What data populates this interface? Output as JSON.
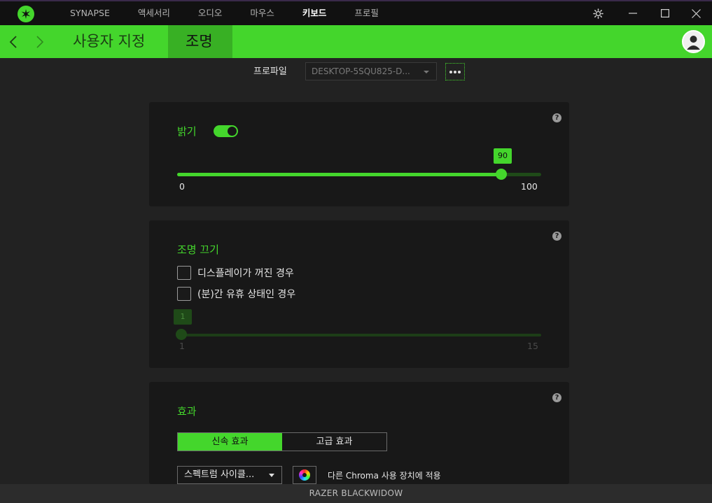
{
  "app": {
    "nav": [
      {
        "label": "SYNAPSE",
        "active": false
      },
      {
        "label": "액세서리",
        "active": false
      },
      {
        "label": "오디오",
        "active": false
      },
      {
        "label": "마우스",
        "active": false
      },
      {
        "label": "키보드",
        "active": true
      },
      {
        "label": "프로필",
        "active": false
      }
    ]
  },
  "header": {
    "tabs": [
      {
        "label": "사용자 지정",
        "active": false
      },
      {
        "label": "조명",
        "active": true
      }
    ]
  },
  "profile": {
    "label": "프로파일",
    "selected": "DESKTOP-5SQU825-D..."
  },
  "brightness": {
    "title": "밝기",
    "enabled": true,
    "value": "90",
    "min": "0",
    "max": "100",
    "help": "?"
  },
  "lighting_off": {
    "title": "조명 끄기",
    "options": [
      {
        "label": "디스플레이가 꺼진 경우",
        "checked": false
      },
      {
        "label": "(분)간 유휴 상태인 경우",
        "checked": false
      }
    ],
    "value": "1",
    "min": "1",
    "max": "15",
    "help": "?"
  },
  "effects": {
    "title": "효과",
    "modes": [
      {
        "label": "신속 효과",
        "active": true
      },
      {
        "label": "고급 효과",
        "active": false
      }
    ],
    "selected_effect": "스펙트럼 사이클...",
    "chroma_label": "다른 Chroma 사용 장치에 적용",
    "help": "?"
  },
  "footer": {
    "device": "RAZER BLACKWIDOW"
  },
  "colors": {
    "accent": "#44d62c",
    "accent_dark": "#38b024",
    "background": "#222222",
    "card": "#181818",
    "inactive_slider": "#1f4a18"
  },
  "icons": {
    "logo": "razer-logo-icon",
    "settings": "gear-icon",
    "minimize": "minimize-icon",
    "maximize": "maximize-icon",
    "close": "close-icon",
    "back": "chevron-left-icon",
    "forward": "chevron-right-icon",
    "avatar": "user-avatar-icon",
    "more": "more-dots-icon",
    "chroma": "color-wheel-icon"
  }
}
